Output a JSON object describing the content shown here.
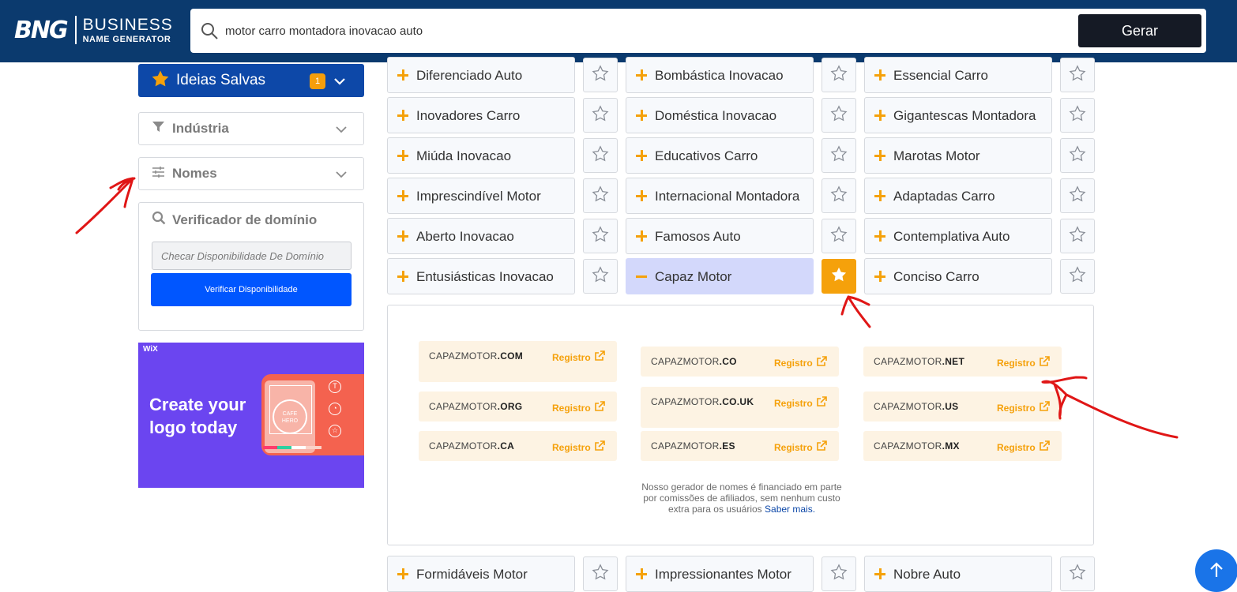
{
  "header": {
    "logo_mark": "BNG",
    "logo_line1": "BUSINESS",
    "logo_line2": "NAME GENERATOR",
    "search_value": "motor carro montadora inovacao auto",
    "generate_label": "Gerar"
  },
  "sidebar": {
    "saved_label": "Ideias Salvas",
    "saved_count": "1",
    "industry_label": "Indústria",
    "names_label": "Nomes",
    "domain_checker_title": "Verificador de domínio",
    "domain_placeholder": "Checar Disponibilidade De Domínio",
    "verify_label": "Verificar Disponibilidade"
  },
  "ad": {
    "brand": "WiX",
    "title": "Create your logo today",
    "badge_text": "CAFE HERO"
  },
  "names": [
    [
      "Diferenciado Auto",
      "Bombástica Inovacao",
      "Essencial Carro"
    ],
    [
      "Inovadores Carro",
      "Doméstica Inovacao",
      "Gigantescas Montadora"
    ],
    [
      "Miúda Inovacao",
      "Educativos Carro",
      "Marotas Motor"
    ],
    [
      "Imprescindível Motor",
      "Internacional Montadora",
      "Adaptadas Carro"
    ],
    [
      "Aberto Inovacao",
      "Famosos Auto",
      "Contemplativa Auto"
    ],
    [
      "Entusiásticas Inovacao",
      "Capaz Motor",
      "Conciso Carro"
    ]
  ],
  "selected_name": "Capaz Motor",
  "domains": {
    "register_label": "Registro",
    "items": [
      {
        "base": "CAPAZMOTOR",
        "tld": ".COM"
      },
      {
        "base": "CAPAZMOTOR",
        "tld": ".CO"
      },
      {
        "base": "CAPAZMOTOR",
        "tld": ".NET"
      },
      {
        "base": "CAPAZMOTOR",
        "tld": ".ORG"
      },
      {
        "base": "CAPAZMOTOR",
        "tld": ".CO.UK"
      },
      {
        "base": "CAPAZMOTOR",
        "tld": ".US"
      },
      {
        "base": "CAPAZMOTOR",
        "tld": ".CA"
      },
      {
        "base": "CAPAZMOTOR",
        "tld": ".ES"
      },
      {
        "base": "CAPAZMOTOR",
        "tld": ".MX"
      }
    ],
    "disclaimer": "Nosso gerador de nomes é financiado em parte por comissões de afiliados, sem nenhum custo extra para os usuários",
    "learn_more": "Saber mais."
  },
  "more_names": [
    "Formidáveis Motor",
    "Impressionantes Motor",
    "Nobre Auto"
  ],
  "colors": {
    "header_bg": "#0b3a6e",
    "accent_orange": "#f5a10b",
    "primary_blue": "#0056ff",
    "saved_bg": "#0d48a8",
    "selected_bg": "#d3d8fb",
    "annotation_red": "#e01616"
  }
}
